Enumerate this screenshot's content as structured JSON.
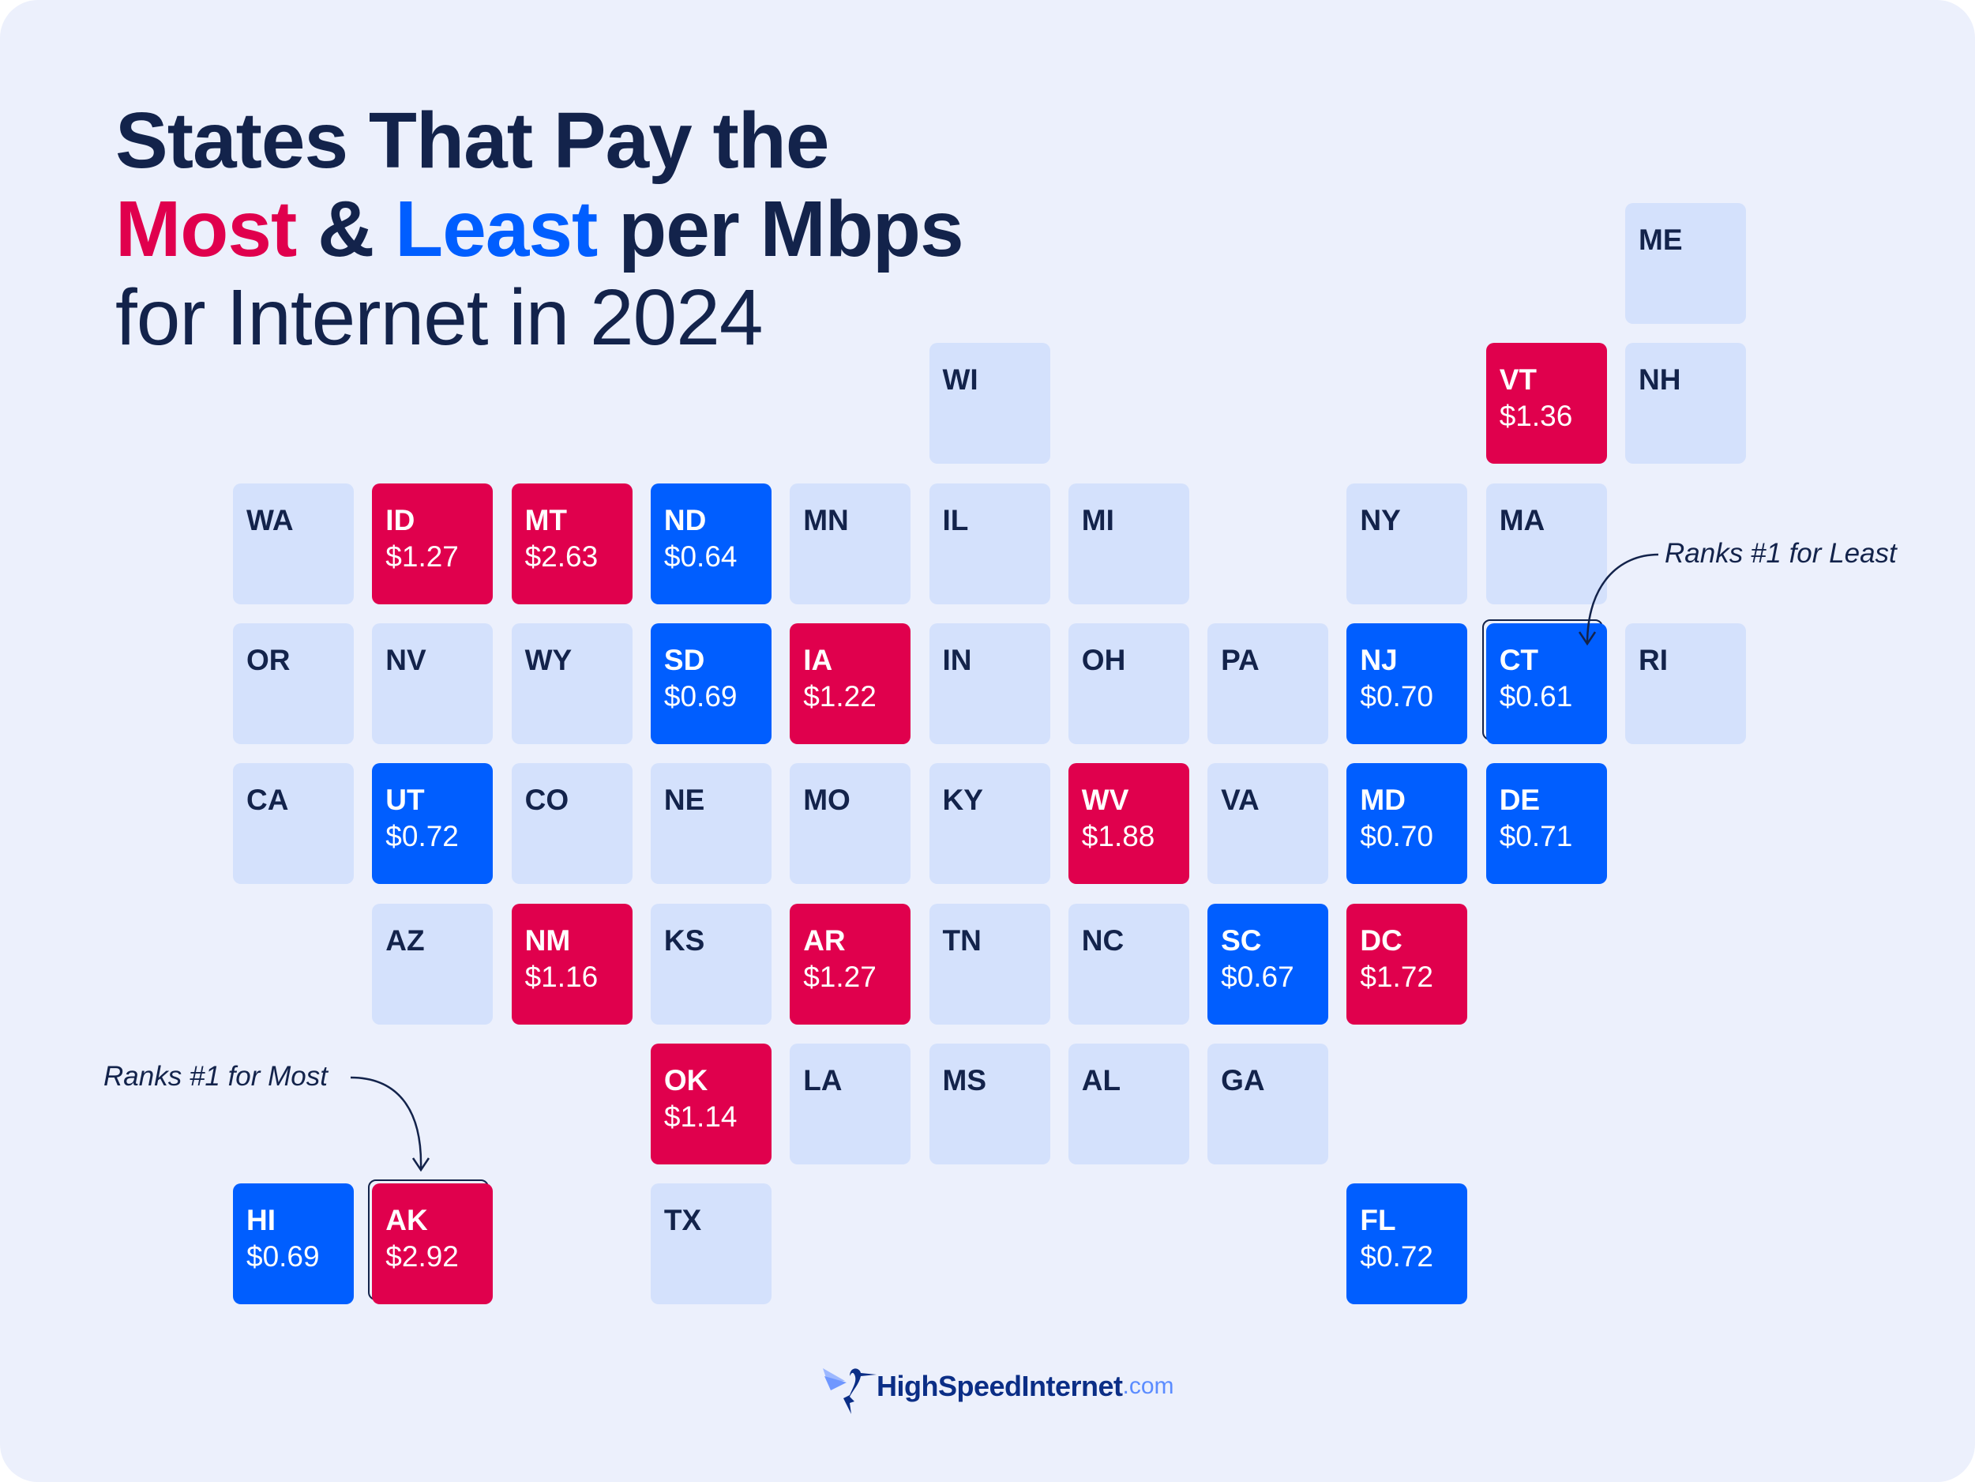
{
  "title": {
    "line1": "States That Pay the",
    "most": "Most",
    "amp": " & ",
    "least": "Least",
    "line2_rest": " per Mbps",
    "line3": "for Internet in 2024"
  },
  "colors": {
    "most": "#E0004D",
    "least": "#005EFF",
    "neutral": "#D4E1FC",
    "background": "#ECF0FC",
    "text": "#13234B"
  },
  "annotations": {
    "most": "Ranks #1 for Most",
    "least": "Ranks #1 for Least"
  },
  "logo": {
    "name": "HighSpeedInternet",
    "tld": ".com"
  },
  "chart_data": {
    "type": "tile-map",
    "title": "States That Pay the Most & Least per Mbps for Internet in 2024",
    "categories": [
      "most",
      "least",
      "neutral"
    ],
    "states": [
      {
        "state": "ME",
        "value": null,
        "category": "neutral"
      },
      {
        "state": "WI",
        "value": null,
        "category": "neutral"
      },
      {
        "state": "VT",
        "value": "$1.36",
        "category": "most"
      },
      {
        "state": "NH",
        "value": null,
        "category": "neutral"
      },
      {
        "state": "WA",
        "value": null,
        "category": "neutral"
      },
      {
        "state": "ID",
        "value": "$1.27",
        "category": "most"
      },
      {
        "state": "MT",
        "value": "$2.63",
        "category": "most"
      },
      {
        "state": "ND",
        "value": "$0.64",
        "category": "least"
      },
      {
        "state": "MN",
        "value": null,
        "category": "neutral"
      },
      {
        "state": "IL",
        "value": null,
        "category": "neutral"
      },
      {
        "state": "MI",
        "value": null,
        "category": "neutral"
      },
      {
        "state": "NY",
        "value": null,
        "category": "neutral"
      },
      {
        "state": "MA",
        "value": null,
        "category": "neutral"
      },
      {
        "state": "OR",
        "value": null,
        "category": "neutral"
      },
      {
        "state": "NV",
        "value": null,
        "category": "neutral"
      },
      {
        "state": "WY",
        "value": null,
        "category": "neutral"
      },
      {
        "state": "SD",
        "value": "$0.69",
        "category": "least"
      },
      {
        "state": "IA",
        "value": "$1.22",
        "category": "most"
      },
      {
        "state": "IN",
        "value": null,
        "category": "neutral"
      },
      {
        "state": "OH",
        "value": null,
        "category": "neutral"
      },
      {
        "state": "PA",
        "value": null,
        "category": "neutral"
      },
      {
        "state": "NJ",
        "value": "$0.70",
        "category": "least"
      },
      {
        "state": "CT",
        "value": "$0.61",
        "category": "least",
        "rank1": "least"
      },
      {
        "state": "RI",
        "value": null,
        "category": "neutral"
      },
      {
        "state": "CA",
        "value": null,
        "category": "neutral"
      },
      {
        "state": "UT",
        "value": "$0.72",
        "category": "least"
      },
      {
        "state": "CO",
        "value": null,
        "category": "neutral"
      },
      {
        "state": "NE",
        "value": null,
        "category": "neutral"
      },
      {
        "state": "MO",
        "value": null,
        "category": "neutral"
      },
      {
        "state": "KY",
        "value": null,
        "category": "neutral"
      },
      {
        "state": "WV",
        "value": "$1.88",
        "category": "most"
      },
      {
        "state": "VA",
        "value": null,
        "category": "neutral"
      },
      {
        "state": "MD",
        "value": "$0.70",
        "category": "least"
      },
      {
        "state": "DE",
        "value": "$0.71",
        "category": "least"
      },
      {
        "state": "AZ",
        "value": null,
        "category": "neutral"
      },
      {
        "state": "NM",
        "value": "$1.16",
        "category": "most"
      },
      {
        "state": "KS",
        "value": null,
        "category": "neutral"
      },
      {
        "state": "AR",
        "value": "$1.27",
        "category": "most"
      },
      {
        "state": "TN",
        "value": null,
        "category": "neutral"
      },
      {
        "state": "NC",
        "value": null,
        "category": "neutral"
      },
      {
        "state": "SC",
        "value": "$0.67",
        "category": "least"
      },
      {
        "state": "DC",
        "value": "$1.72",
        "category": "most"
      },
      {
        "state": "OK",
        "value": "$1.14",
        "category": "most"
      },
      {
        "state": "LA",
        "value": null,
        "category": "neutral"
      },
      {
        "state": "MS",
        "value": null,
        "category": "neutral"
      },
      {
        "state": "AL",
        "value": null,
        "category": "neutral"
      },
      {
        "state": "GA",
        "value": null,
        "category": "neutral"
      },
      {
        "state": "HI",
        "value": "$0.69",
        "category": "least"
      },
      {
        "state": "AK",
        "value": "$2.92",
        "category": "most",
        "rank1": "most"
      },
      {
        "state": "TX",
        "value": null,
        "category": "neutral"
      },
      {
        "state": "FL",
        "value": "$0.72",
        "category": "least"
      }
    ]
  }
}
